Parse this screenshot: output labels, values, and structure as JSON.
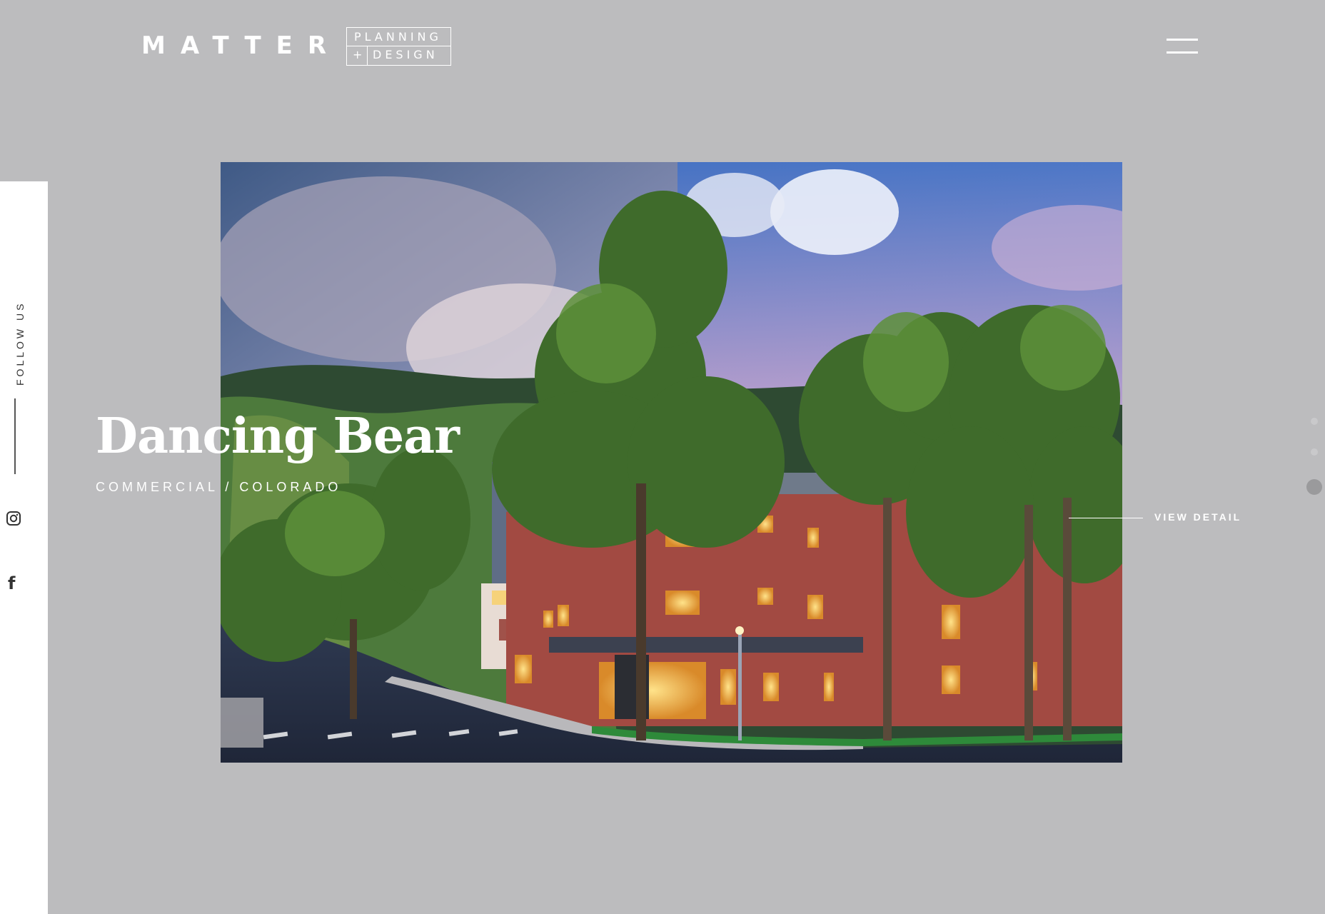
{
  "brand": {
    "name": "MATTER",
    "tagline_line1": "PLANNING",
    "tagline_plus": "+",
    "tagline_line2": "DESIGN"
  },
  "header": {
    "menu_icon": "hamburger-menu-icon"
  },
  "sidebar": {
    "follow_label": "FOLLOW US",
    "social": [
      {
        "name": "instagram",
        "icon": "instagram-icon"
      },
      {
        "name": "facebook",
        "icon": "facebook-icon",
        "glyph": "f"
      }
    ]
  },
  "project": {
    "title": "Dancing Bear",
    "subtitle": "COMMERCIAL / COLORADO",
    "cta": "VIEW DETAIL"
  },
  "slider": {
    "total": 3,
    "active": 3
  },
  "colors": {
    "background": "#bcbcbe",
    "sidebar": "#ffffff",
    "text_on_image": "#ffffff"
  }
}
